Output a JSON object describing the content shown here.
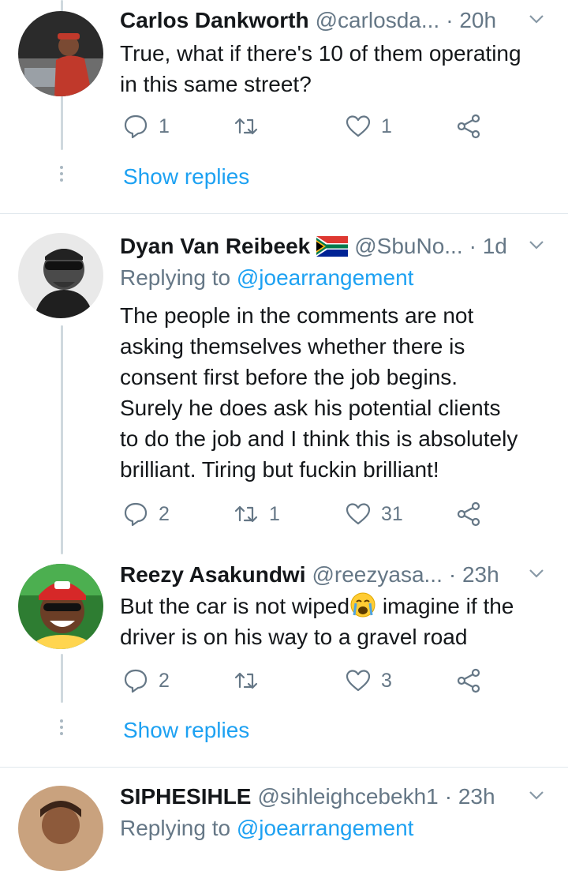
{
  "colors": {
    "accent": "#1da1f2",
    "muted": "#657786",
    "text": "#14171a"
  },
  "tweets": [
    {
      "name": "Carlos Dankworth",
      "handle": "@carlosda...",
      "time": "· 20h",
      "replying_prefix": "",
      "replying_to": "",
      "lines": [
        "True, what if there's 10 of them operating",
        "in this same street?"
      ],
      "replies": "1",
      "retweets": "",
      "likes": "1",
      "show_replies": "Show replies"
    },
    {
      "name": "Dyan Van Reibeek",
      "flag": "south-africa-flag",
      "handle": "@SbuNo...",
      "time": "· 1d",
      "replying_prefix": "Replying to",
      "replying_to": "@joearrangement",
      "lines": [
        "The people in the comments are not",
        "asking themselves whether there is",
        "consent first before the job begins.",
        "Surely he does ask his potential clients",
        "to do the job and I think this is absolutely",
        "brilliant. Tiring but fuckin brilliant!"
      ],
      "replies": "2",
      "retweets": "1",
      "likes": "31"
    },
    {
      "name": "Reezy Asakundwi",
      "handle": "@reezyasa...",
      "time": "· 23h",
      "line1_a": "But the car is not wiped",
      "emoji": "crying-face-emoji",
      "line1_b": " imagine if the",
      "line2": "driver is on his way to a gravel road",
      "replies": "2",
      "retweets": "",
      "likes": "3",
      "show_replies": "Show replies"
    },
    {
      "name": "SIPHESIHLE",
      "handle": "@sihleighcebekh1",
      "time": "· 23h",
      "replying_prefix": "Replying to",
      "replying_to": "@joearrangement"
    }
  ]
}
